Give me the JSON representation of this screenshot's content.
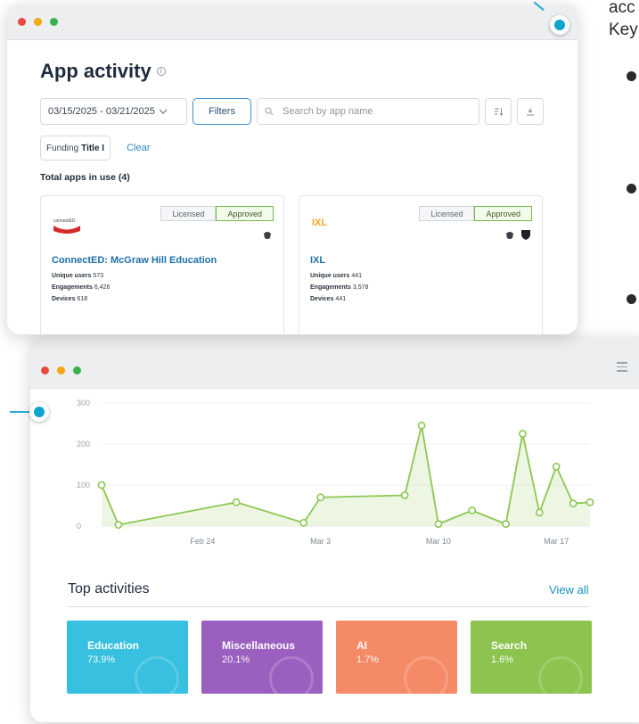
{
  "side_text": {
    "line1": "acc",
    "line2": "Key"
  },
  "window1": {
    "title": "App activity",
    "info_glyph": "i",
    "date_range": "03/15/2025 - 03/21/2025",
    "filters_label": "Filters",
    "search_placeholder": "Search by app name",
    "filter_chip": {
      "prefix": "Funding",
      "value": "Title I"
    },
    "clear_label": "Clear",
    "total_label": "Total apps in use (4)",
    "cards": [
      {
        "name": "ConnectED: McGraw Hill Education",
        "logo_text": "connectED",
        "licensed_label": "Licensed",
        "approved_label": "Approved",
        "unique_users_label": "Unique users",
        "unique_users": "573",
        "engagements_label": "Engagements",
        "engagements": "6,426",
        "devices_label": "Devices",
        "devices": "618"
      },
      {
        "name": "IXL",
        "logo_text": "IXL",
        "licensed_label": "Licensed",
        "approved_label": "Approved",
        "unique_users_label": "Unique users",
        "unique_users": "441",
        "engagements_label": "Engagements",
        "engagements": "3,578",
        "devices_label": "Devices",
        "devices": "441"
      }
    ]
  },
  "window2": {
    "top_activities_title": "Top activities",
    "view_all_label": "View all",
    "activities": [
      {
        "name": "Education",
        "value": "73.9%",
        "color": "#38c0e0"
      },
      {
        "name": "Miscellaneous",
        "value": "20.1%",
        "color": "#9b5fc0"
      },
      {
        "name": "AI",
        "value": "1.7%",
        "color": "#f58a66"
      },
      {
        "name": "Search",
        "value": "1.6%",
        "color": "#8dc34f"
      }
    ]
  },
  "chart_data": {
    "type": "area",
    "yticks": [
      "300",
      "200",
      "100",
      "0"
    ],
    "ylim": [
      0,
      300
    ],
    "xticks": [
      {
        "date": "2025-02-24",
        "label": "Feb 24"
      },
      {
        "date": "2025-03-03",
        "label": "Mar 3"
      },
      {
        "date": "2025-03-10",
        "label": "Mar 10"
      },
      {
        "date": "2025-03-17",
        "label": "Mar 17"
      }
    ],
    "series": [
      {
        "color": "#8cc751",
        "points": [
          {
            "x": "2025-02-18",
            "y": 100
          },
          {
            "x": "2025-02-19",
            "y": 3
          },
          {
            "x": "2025-02-26",
            "y": 58
          },
          {
            "x": "2025-03-02",
            "y": 8
          },
          {
            "x": "2025-03-03",
            "y": 70
          },
          {
            "x": "2025-03-08",
            "y": 75
          },
          {
            "x": "2025-03-09",
            "y": 245
          },
          {
            "x": "2025-03-10",
            "y": 5
          },
          {
            "x": "2025-03-12",
            "y": 38
          },
          {
            "x": "2025-03-14",
            "y": 5
          },
          {
            "x": "2025-03-15",
            "y": 225
          },
          {
            "x": "2025-03-16",
            "y": 33
          },
          {
            "x": "2025-03-17",
            "y": 145
          },
          {
            "x": "2025-03-18",
            "y": 55
          },
          {
            "x": "2025-03-19",
            "y": 58
          }
        ]
      }
    ]
  }
}
